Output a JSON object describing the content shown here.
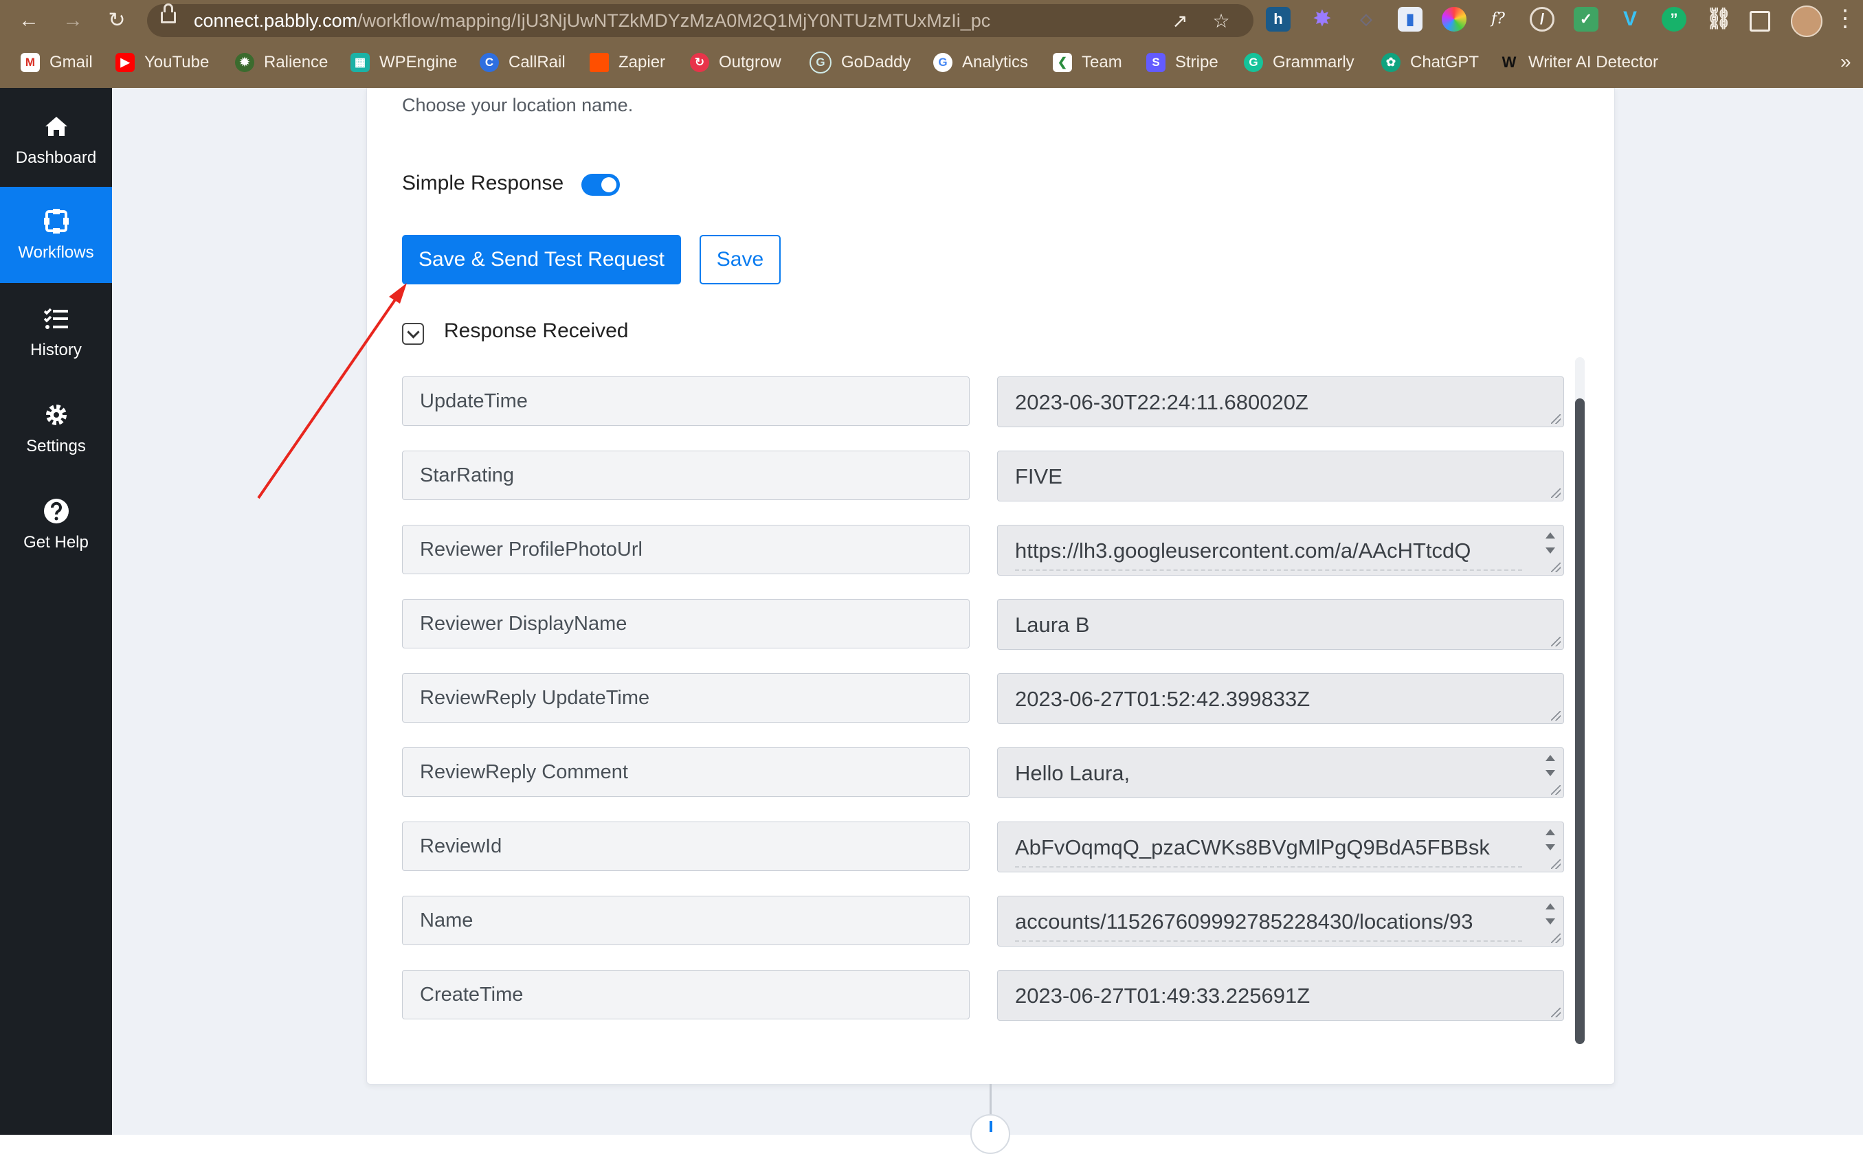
{
  "browser": {
    "url_host": "connect.pabbly.com",
    "url_path": "/workflow/mapping/IjU3NjUwNTZkMDYzMzA0M2Q1MjY0NTUzMTUxMzIi_pc",
    "bookmarks": [
      "Gmail",
      "YouTube",
      "Ralience",
      "WPEngine",
      "CallRail",
      "Zapier",
      "Outgrow",
      "GoDaddy",
      "Analytics",
      "Team",
      "Stripe",
      "Grammarly",
      "ChatGPT",
      "Writer AI Detector"
    ],
    "more": "»"
  },
  "sidebar": {
    "items": [
      {
        "label": "Dashboard",
        "icon": "home-icon"
      },
      {
        "label": "Workflows",
        "icon": "workflow-icon",
        "active": true
      },
      {
        "label": "History",
        "icon": "history-list-icon"
      },
      {
        "label": "Settings",
        "icon": "gear-icon"
      },
      {
        "label": "Get Help",
        "icon": "help-icon"
      }
    ]
  },
  "form": {
    "hint": "Choose your location name.",
    "simple_response_label": "Simple Response",
    "simple_response_on": true,
    "save_send_label": "Save & Send Test Request",
    "save_label": "Save",
    "response_title": "Response Received"
  },
  "response": [
    {
      "key": "UpdateTime",
      "value": "2023-06-30T22:24:11.680020Z"
    },
    {
      "key": "StarRating",
      "value": "FIVE"
    },
    {
      "key": "Reviewer ProfilePhotoUrl",
      "value": "https://lh3.googleusercontent.com/a/AAcHTtcdQ"
    },
    {
      "key": "Reviewer DisplayName",
      "value": "Laura B"
    },
    {
      "key": "ReviewReply UpdateTime",
      "value": "2023-06-27T01:52:42.399833Z"
    },
    {
      "key": "ReviewReply Comment",
      "value": "Hello Laura,"
    },
    {
      "key": "ReviewId",
      "value": "AbFvOqmqQ_pzaCWKs8BVgMlPgQ9BdA5FBBsk"
    },
    {
      "key": "Name",
      "value": "accounts/115267609992785228430/locations/93"
    },
    {
      "key": "CreateTime",
      "value": "2023-06-27T01:49:33.225691Z"
    }
  ],
  "colors": {
    "accent": "#0a7cf0",
    "sidebar": "#1b1f24",
    "annotation_arrow": "#e8261e"
  }
}
